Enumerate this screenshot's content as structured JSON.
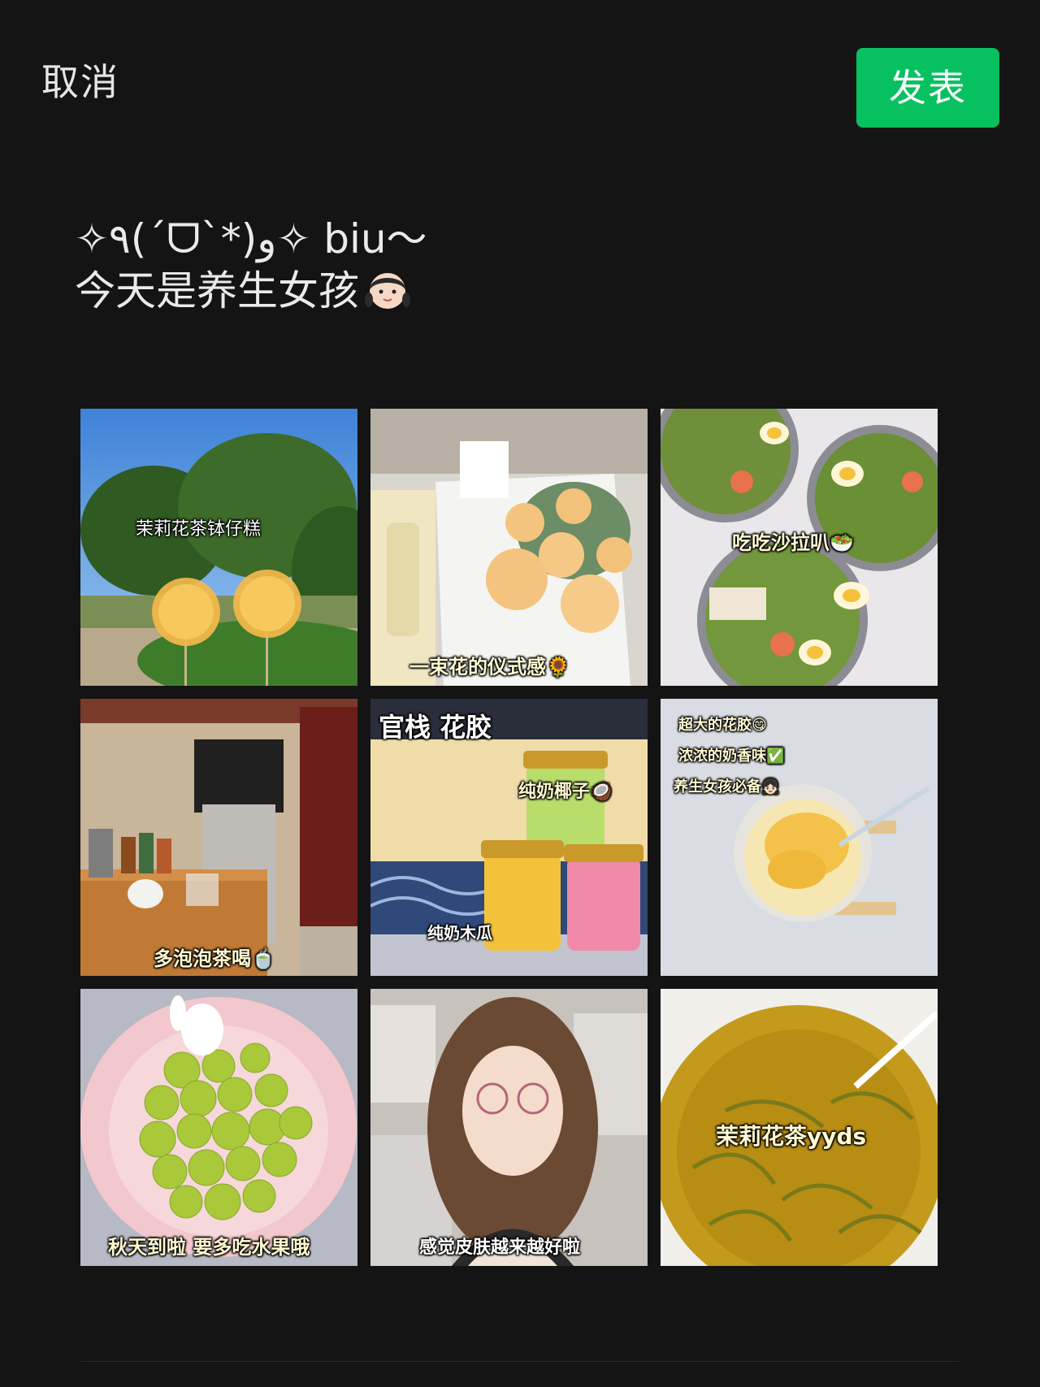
{
  "header": {
    "cancel_label": "取消",
    "publish_label": "发表"
  },
  "post": {
    "line1": "✧٩(ˊᗜˋ*)و✧ biu～",
    "line2": "今天是养生女孩"
  },
  "photos": [
    {
      "caption": "茉莉花茶钵仔糕"
    },
    {
      "caption": "一束花的仪式感🌻"
    },
    {
      "caption": "吃吃沙拉叭🥗"
    },
    {
      "caption": "多泡泡茶喝🍵"
    },
    {
      "caption": "官栈 花胶",
      "caption2": "纯奶椰子🥥",
      "caption3": "纯奶木瓜"
    },
    {
      "caption": "超大的花胶😋",
      "caption2": "浓浓的奶香味✅",
      "caption3": "养生女孩必备👧🏻"
    },
    {
      "caption": "秋天到啦 要多吃水果哦"
    },
    {
      "caption": "感觉皮肤越来越好啦"
    },
    {
      "caption": "茉莉花茶yyds"
    }
  ],
  "colors": {
    "background": "#141414",
    "publish_button": "#07c160",
    "text": "#eaeaea"
  }
}
